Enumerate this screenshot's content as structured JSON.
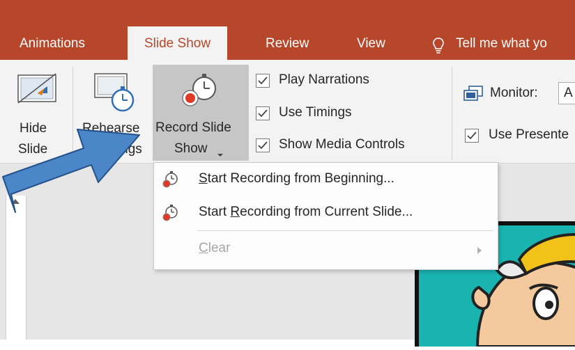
{
  "tabs": [
    {
      "label": "Animations"
    },
    {
      "label": "Slide Show"
    },
    {
      "label": "Review"
    },
    {
      "label": "View"
    },
    {
      "label": "Tell me what yo"
    }
  ],
  "ribbon": {
    "hide_slide": {
      "line1": "Hide",
      "line2": "Slide"
    },
    "rehearse": {
      "line1": "Rehearse",
      "line2": "Timings"
    },
    "record": {
      "line1": "Record Slide",
      "line2": "Show"
    },
    "checks": [
      {
        "label": "Play Narrations",
        "checked": true
      },
      {
        "label": "Use Timings",
        "checked": true
      },
      {
        "label": "Show Media Controls",
        "checked": true
      }
    ],
    "monitor_label": "Monitor:",
    "monitor_value": "A",
    "presenter_label": "Use Presente",
    "presenter_checked": true
  },
  "dropdown": {
    "items": [
      {
        "pre": "",
        "key": "S",
        "post": "tart Recording from Beginning...",
        "icon": "record-timer-icon",
        "enabled": true
      },
      {
        "pre": "Start ",
        "key": "R",
        "post": "ecording from Current Slide...",
        "icon": "record-timer-icon",
        "enabled": true
      },
      {
        "pre": "",
        "key": "C",
        "post": "lear",
        "icon": "",
        "enabled": false,
        "submenu": true
      }
    ]
  },
  "colors": {
    "accent": "#b7472a",
    "ribbon_bg": "#f3f3f3",
    "arrow": "#4a86c8",
    "selected_button": "#c6c6c6"
  }
}
